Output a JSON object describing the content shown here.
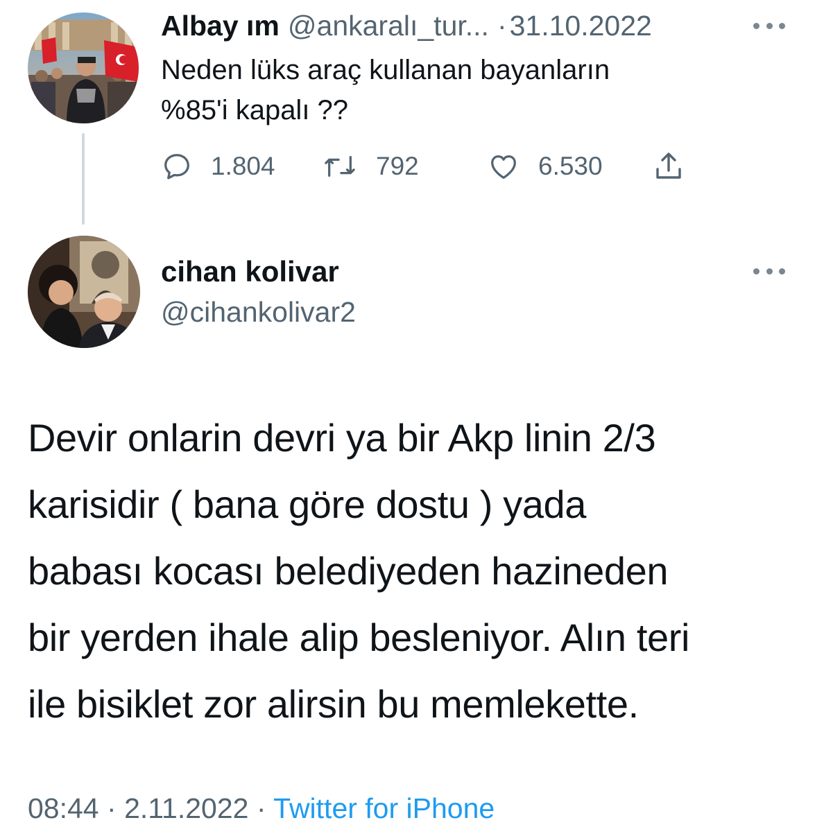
{
  "parent_tweet": {
    "display_name": "Albay ım",
    "handle": "@ankaralı_tur...",
    "separator": "·",
    "date": "31.10.2022",
    "text_lines": [
      "Neden lüks araç kullanan bayanların",
      "%85'i kapalı ??"
    ],
    "metrics": {
      "replies": "1.804",
      "retweets": "792",
      "likes": "6.530"
    },
    "avatar_icon": "profile-photo"
  },
  "reply_tweet": {
    "display_name": "cihan kolivar",
    "handle": "@cihankolivar2",
    "avatar_icon": "profile-photo",
    "text_lines": [
      "Devir onlarin devri ya bir Akp linin 2/3",
      "karisidir ( bana göre dostu ) yada",
      "babası kocası belediyeden hazineden",
      "bir yerden ihale alip besleniyor. Alın teri",
      "ile bisiklet zor alirsin bu memlekette."
    ],
    "time": "08:44",
    "separator": "·",
    "date": "2.11.2022",
    "source": "Twitter for iPhone"
  },
  "icons": {
    "reply": "reply-icon",
    "retweet": "retweet-icon",
    "like": "heart-icon",
    "share": "share-icon",
    "more": "more-dots-icon"
  },
  "colors": {
    "text": "#0f1419",
    "muted": "#536471",
    "link": "#1d9bf0",
    "thread_line": "#cfd9de"
  }
}
